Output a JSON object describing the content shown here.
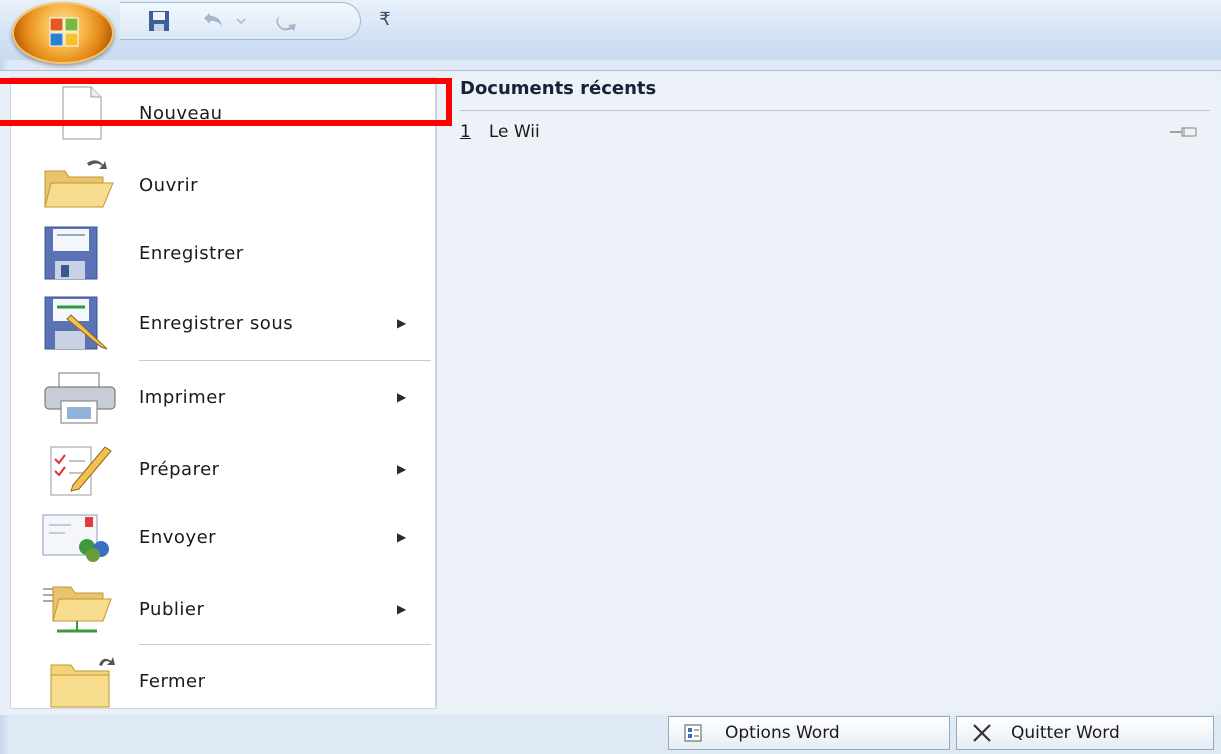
{
  "menu": {
    "items": [
      {
        "label": "Nouveau",
        "icon": "new-document-icon",
        "has_submenu": false
      },
      {
        "label": "Ouvrir",
        "icon": "open-folder-icon",
        "has_submenu": false
      },
      {
        "label": "Enregistrer",
        "icon": "save-icon",
        "has_submenu": false
      },
      {
        "label": "Enregistrer sous",
        "icon": "save-as-icon",
        "has_submenu": true
      },
      {
        "label": "Imprimer",
        "icon": "printer-icon",
        "has_submenu": true
      },
      {
        "label": "Préparer",
        "icon": "prepare-document-icon",
        "has_submenu": true
      },
      {
        "label": "Envoyer",
        "icon": "send-icon",
        "has_submenu": true
      },
      {
        "label": "Publier",
        "icon": "publish-icon",
        "has_submenu": true
      },
      {
        "label": "Fermer",
        "icon": "close-folder-icon",
        "has_submenu": false
      }
    ],
    "submenu_arrow": "▶"
  },
  "recent": {
    "title": "Documents récents",
    "items": [
      {
        "number": "1",
        "name": "Le Wii"
      }
    ]
  },
  "footer": {
    "options_label": "Options Word",
    "quit_label": "Quitter Word"
  },
  "quick_access": {
    "customize_glyph": "₹"
  },
  "colors": {
    "highlight": "#ff0000",
    "office_orange": "#f7b545"
  }
}
